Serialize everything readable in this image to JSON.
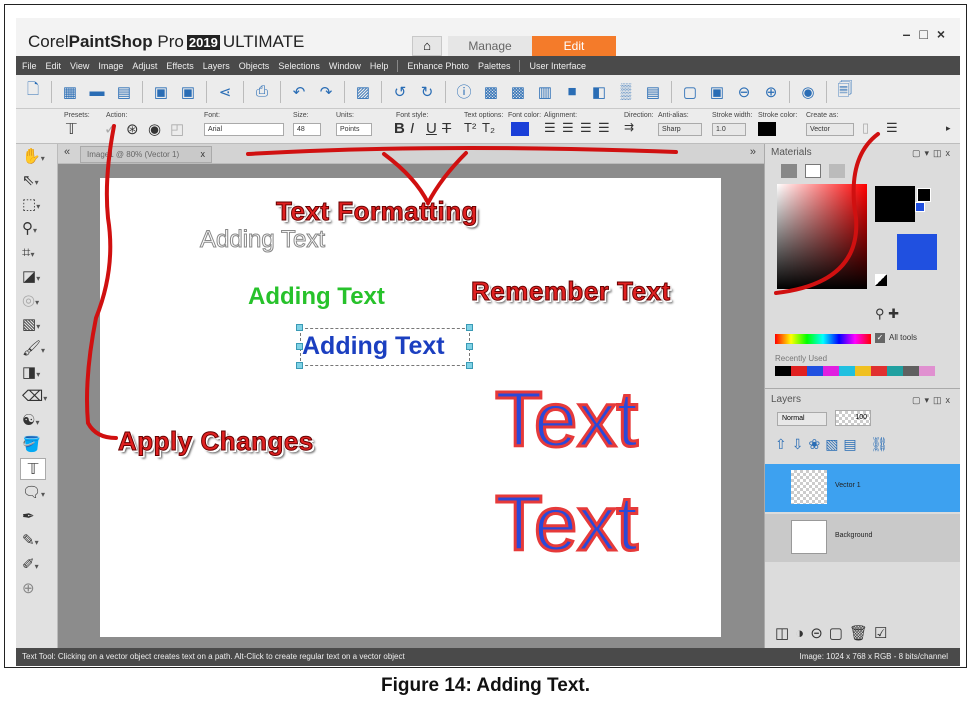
{
  "app": {
    "brand": "Corel",
    "product": "PaintShop",
    "pro": "Pro",
    "year": "2019",
    "edition": "ULTIMATE",
    "tabs": [
      "Manage",
      "Edit"
    ],
    "window_controls": "–□×"
  },
  "menu": [
    "File",
    "Edit",
    "View",
    "Image",
    "Adjust",
    "Effects",
    "Layers",
    "Objects",
    "Selections",
    "Window",
    "Help",
    "Enhance Photo",
    "Palettes",
    "User Interface"
  ],
  "tool_options": {
    "presets_label": "Presets:",
    "action_label": "Action:",
    "font_label": "Font:",
    "font_value": "Arial",
    "size_label": "Size:",
    "size_value": "48",
    "units_label": "Units:",
    "units_value": "Points",
    "font_style_label": "Font style:",
    "text_options_label": "Text options:",
    "font_color_label": "Font color:",
    "alignment_label": "Alignment:",
    "direction_label": "Direction:",
    "antialias_label": "Anti-alias:",
    "antialias_value": "Sharp",
    "stroke_width_label": "Stroke width:",
    "stroke_width_value": "1.0",
    "stroke_color_label": "Stroke color:",
    "create_as_label": "Create as:",
    "create_as_value": "Vector",
    "font_color": "#1a3fd8",
    "stroke_color": "#000000"
  },
  "document": {
    "tab_label": "Image1 @ 80% (Vector 1)",
    "texts": [
      "Adding Text",
      "Adding Text",
      "Adding Text",
      "Text",
      "Text"
    ]
  },
  "materials": {
    "title": "Materials",
    "all_tools_label": "All tools",
    "recently_used_label": "Recently Used",
    "recent_colors": [
      "#000000",
      "#e02020",
      "#2050e0",
      "#e020e0",
      "#20c0e0",
      "#f0c020",
      "#e03030",
      "#20a0a0",
      "#606060",
      "#e090d0"
    ]
  },
  "layers": {
    "title": "Layers",
    "blend_mode": "Normal",
    "opacity": "100",
    "items": [
      {
        "name": "Vector 1",
        "selected": true
      },
      {
        "name": "Background",
        "selected": false
      }
    ]
  },
  "status": {
    "left": "Text Tool: Clicking on a vector object creates text on a path. Alt-Click to create regular text on a vector object",
    "right": "Image: 1024 x 768 x RGB - 8 bits/channel"
  },
  "annotations": {
    "text_formatting": "Text Formatting",
    "remember_text": "Remember Text",
    "apply_changes": "Apply Changes"
  },
  "caption": "Figure 14: Adding Text."
}
